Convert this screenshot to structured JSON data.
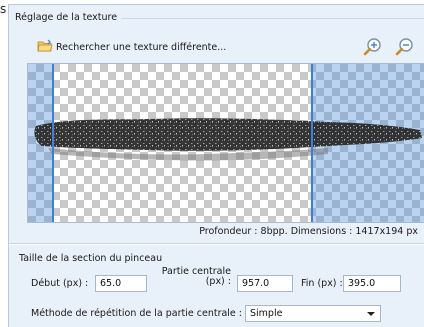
{
  "edge_char": "s",
  "texture_group": {
    "title": "Réglage de la texture",
    "browse_label": "Rechercher une texture différente...",
    "zoom_in_icon": "zoom-in-icon",
    "zoom_out_icon": "zoom-out-icon",
    "info": "Profondeur : 8bpp. Dimensions : 1417x194 px"
  },
  "section_group": {
    "title": "Taille de la section du pinceau",
    "start_label": "Début (px) :",
    "start_value": "65.0",
    "center_label_line1": "Partie centrale",
    "center_label_line2": "(px) :",
    "center_value": "957.0",
    "end_label": "Fin (px) :",
    "end_value": "395.0",
    "repeat_label": "Méthode de répétition de la partie centrale :",
    "repeat_value": "Simple"
  },
  "colors": {
    "accent": "#3f7fd6",
    "panel": "#e8f0fa",
    "folder": "#e8b43a"
  }
}
